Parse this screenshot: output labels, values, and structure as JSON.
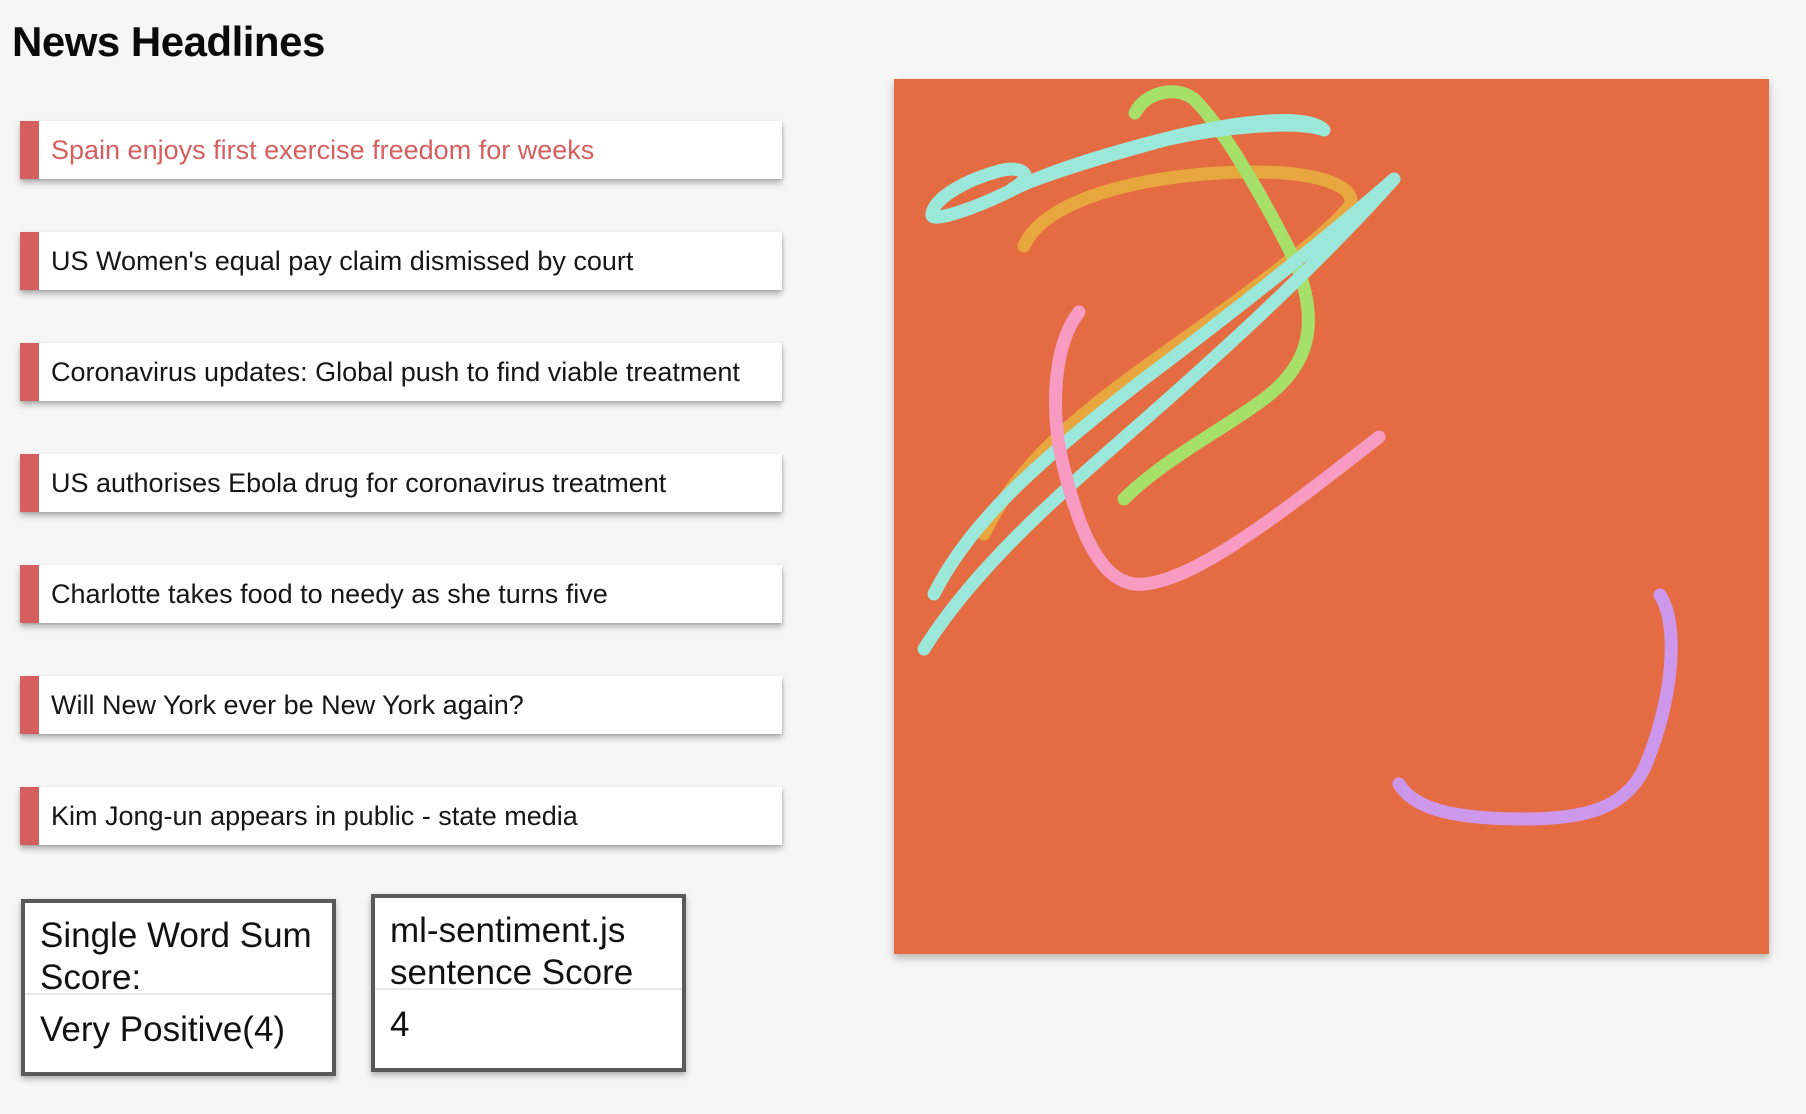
{
  "page": {
    "title": "News Headlines"
  },
  "headlines": [
    {
      "text": "Spain enjoys first exercise freedom for weeks",
      "active": true
    },
    {
      "text": "US Women's equal pay claim dismissed by court",
      "active": false
    },
    {
      "text": "Coronavirus updates: Global push to find viable treatment",
      "active": false
    },
    {
      "text": "US authorises Ebola drug for coronavirus treatment",
      "active": false
    },
    {
      "text": "Charlotte takes food to needy as she turns five",
      "active": false
    },
    {
      "text": "Will New York ever be New York again?",
      "active": false
    },
    {
      "text": "Kim Jong-un appears in public - state media",
      "active": false
    }
  ],
  "scores": {
    "single_word": {
      "label": "Single Word Sum Score:",
      "value": "Very Positive(4)"
    },
    "ml_sentiment": {
      "label": "ml-sentiment.js sentence Score",
      "value": "4"
    }
  },
  "colors": {
    "page_background": "#f6f6f6",
    "headline_accent": "#d55e5e",
    "active_headline_text": "#d55e5e",
    "canvas_background": "#e56c42",
    "stroke_cyan": "#9be8db",
    "stroke_amber": "#e7a73e",
    "stroke_green": "#a6e06a",
    "stroke_pink": "#f79bc3",
    "stroke_violet": "#cd97ec",
    "score_border": "#5a5a5a"
  }
}
